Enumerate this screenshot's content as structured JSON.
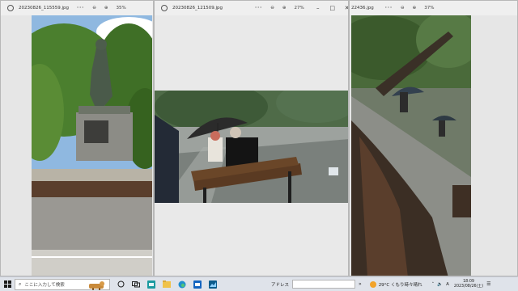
{
  "windows": [
    {
      "filename": "20230826_115559.jpg",
      "more": "···",
      "zoom_out": "⊖",
      "zoom_in": "⊕",
      "zoom": "35%"
    },
    {
      "filename": "20230826_121509.jpg",
      "more": "···",
      "zoom_out": "⊖",
      "zoom_in": "⊕",
      "zoom": "27%",
      "minimize": "–",
      "maximize": "□",
      "close": "✕"
    },
    {
      "filename": "22436.jpg",
      "more": "···",
      "zoom_out": "⊖",
      "zoom_in": "⊕",
      "zoom": "37%"
    }
  ],
  "taskbar": {
    "start_glyph": "⊞",
    "search_icon": "⌕",
    "search_placeholder": "ここに入力して検索",
    "address_label": "アドレス",
    "address_go": "»",
    "weather_text": "29°C くもり時々晴れ",
    "tray_chevron": "˄",
    "tray_volume": "🔈",
    "tray_ime": "A",
    "time": "18:09",
    "date": "2023/08/26(土)",
    "notification": "☰"
  },
  "icons": [
    "search-icon",
    "zoom-out-icon",
    "zoom-in-icon",
    "more-icon",
    "app-icon",
    "minimize-icon",
    "maximize-icon",
    "close-icon",
    "windows-start-icon",
    "task-view-icon",
    "edge-icon",
    "explorer-icon",
    "weather-icon"
  ]
}
